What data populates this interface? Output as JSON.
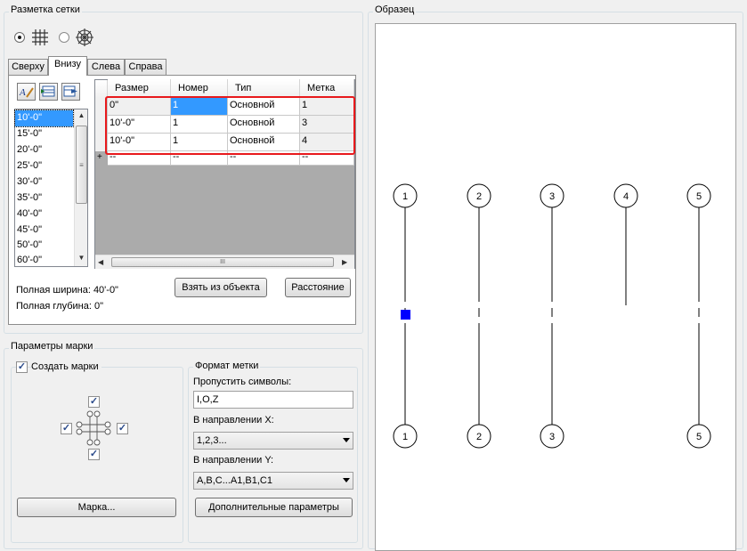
{
  "grid_layout": {
    "title": "Разметка сетки",
    "tabs": [
      {
        "label": "Сверху",
        "active": false
      },
      {
        "label": "Внизу",
        "active": true
      },
      {
        "label": "Слева",
        "active": false
      },
      {
        "label": "Справа",
        "active": false
      }
    ],
    "spacing_list": [
      "10'-0\"",
      "15'-0\"",
      "20'-0\"",
      "25'-0\"",
      "30'-0\"",
      "35'-0\"",
      "40'-0\"",
      "45'-0\"",
      "50'-0\"",
      "60'-0\""
    ],
    "table": {
      "headers": [
        "Размер",
        "Номер",
        "Тип",
        "Метка"
      ],
      "rows": [
        {
          "size": "0\"",
          "number": "1",
          "type": "Основной",
          "label": "1"
        },
        {
          "size": "10'-0\"",
          "number": "1",
          "type": "Основной",
          "label": "3"
        },
        {
          "size": "10'-0\"",
          "number": "1",
          "type": "Основной",
          "label": "4"
        }
      ],
      "new_row": {
        "marker": "+",
        "size": "--",
        "number": "--",
        "type": "--",
        "label": "--"
      },
      "hscroll_grip": "III"
    },
    "button_from_object": "Взять из объекта",
    "button_distance": "Расстояние",
    "total_width": "Полная ширина: 40'-0\"",
    "total_depth": "Полная глубина: 0\""
  },
  "mark_params": {
    "title": "Параметры марки",
    "create_marks_label": "Создать марки",
    "mark_button": "Марка...",
    "format": {
      "title": "Формат метки",
      "skip_label": "Пропустить символы:",
      "skip_value": "I,O,Z",
      "x_dir_label": "В направлении X:",
      "x_dir_value": "1,2,3...",
      "y_dir_label": "В направлении Y:",
      "y_dir_value": "A,B,C...A1,B1,C1",
      "more_button": "Дополнительные параметры"
    }
  },
  "preview": {
    "title": "Образец",
    "top_labels": [
      "1",
      "2",
      "3",
      "4",
      "5"
    ],
    "bottom_labels": [
      "1",
      "2",
      "3",
      "",
      "5"
    ]
  },
  "colors": {
    "highlight": "#e8191c",
    "selection": "#3399ff",
    "grip": "#0000ff"
  }
}
